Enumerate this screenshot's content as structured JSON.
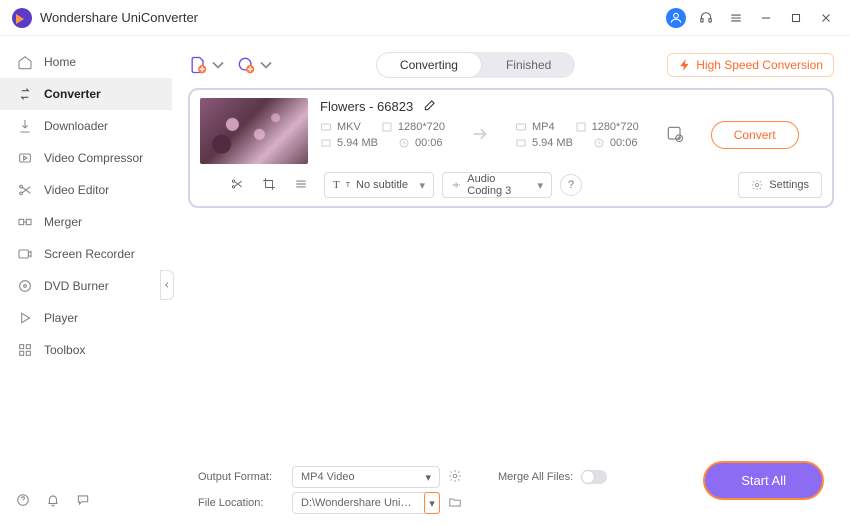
{
  "app": {
    "title": "Wondershare UniConverter"
  },
  "sidebar": {
    "items": [
      {
        "label": "Home"
      },
      {
        "label": "Converter"
      },
      {
        "label": "Downloader"
      },
      {
        "label": "Video Compressor"
      },
      {
        "label": "Video Editor"
      },
      {
        "label": "Merger"
      },
      {
        "label": "Screen Recorder"
      },
      {
        "label": "DVD Burner"
      },
      {
        "label": "Player"
      },
      {
        "label": "Toolbox"
      }
    ]
  },
  "tabs": {
    "converting": "Converting",
    "finished": "Finished"
  },
  "hsc": "High Speed Conversion",
  "file": {
    "name": "Flowers - 66823",
    "src": {
      "format": "MKV",
      "resolution": "1280*720",
      "size": "5.94 MB",
      "duration": "00:06"
    },
    "dst": {
      "format": "MP4",
      "resolution": "1280*720",
      "size": "5.94 MB",
      "duration": "00:06"
    },
    "subtitle": "No subtitle",
    "audio": "Audio Coding 3",
    "convert": "Convert",
    "settings": "Settings"
  },
  "bottom": {
    "outputFormatLabel": "Output Format:",
    "outputFormatValue": "MP4 Video",
    "fileLocationLabel": "File Location:",
    "fileLocationValue": "D:\\Wondershare UniConverter",
    "mergeLabel": "Merge All Files:",
    "startAll": "Start All"
  }
}
